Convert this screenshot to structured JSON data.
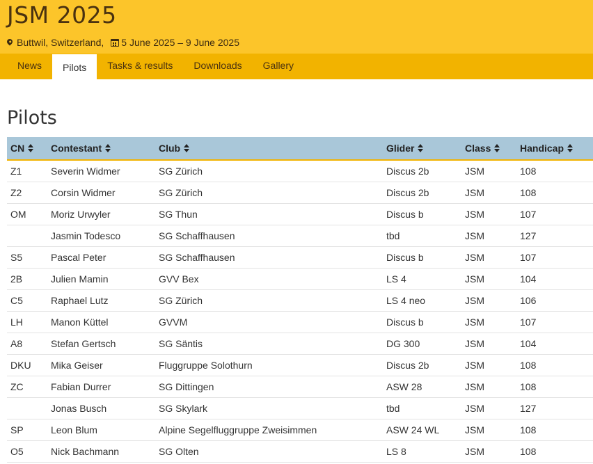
{
  "header": {
    "title": "JSM 2025",
    "location": "Buttwil, Switzerland,",
    "dates": "5 June 2025 – 9 June 2025"
  },
  "nav": {
    "items": [
      {
        "label": "News",
        "active": false
      },
      {
        "label": "Pilots",
        "active": true
      },
      {
        "label": "Tasks & results",
        "active": false
      },
      {
        "label": "Downloads",
        "active": false
      },
      {
        "label": "Gallery",
        "active": false
      }
    ]
  },
  "page_title": "Pilots",
  "table": {
    "columns": [
      "CN",
      "Contestant",
      "Club",
      "Glider",
      "Class",
      "Handicap"
    ],
    "rows": [
      [
        "Z1",
        "Severin Widmer",
        "SG Zürich",
        "Discus 2b",
        "JSM",
        "108"
      ],
      [
        "Z2",
        "Corsin Widmer",
        "SG Zürich",
        "Discus 2b",
        "JSM",
        "108"
      ],
      [
        "OM",
        "Moriz Urwyler",
        "SG Thun",
        "Discus b",
        "JSM",
        "107"
      ],
      [
        "",
        "Jasmin Todesco",
        "SG Schaffhausen",
        "tbd",
        "JSM",
        "127"
      ],
      [
        "S5",
        "Pascal Peter",
        "SG Schaffhausen",
        "Discus b",
        "JSM",
        "107"
      ],
      [
        "2B",
        "Julien Mamin",
        "GVV Bex",
        "LS 4",
        "JSM",
        "104"
      ],
      [
        "C5",
        "Raphael Lutz",
        "SG Zürich",
        "LS 4 neo",
        "JSM",
        "106"
      ],
      [
        "LH",
        "Manon Küttel",
        "GVVM",
        "Discus b",
        "JSM",
        "107"
      ],
      [
        "A8",
        "Stefan Gertsch",
        "SG Säntis",
        "DG 300",
        "JSM",
        "104"
      ],
      [
        "DKU",
        "Mika Geiser",
        "Fluggruppe Solothurn",
        "Discus 2b",
        "JSM",
        "108"
      ],
      [
        "ZC",
        "Fabian Durrer",
        "SG Dittingen",
        "ASW 28",
        "JSM",
        "108"
      ],
      [
        "",
        "Jonas Busch",
        "SG Skylark",
        "tbd",
        "JSM",
        "127"
      ],
      [
        "SP",
        "Leon Blum",
        "Alpine Segelfluggruppe Zweisimmen",
        "ASW 24 WL",
        "JSM",
        "108"
      ],
      [
        "O5",
        "Nick Bachmann",
        "SG Olten",
        "LS 8",
        "JSM",
        "108"
      ]
    ]
  }
}
